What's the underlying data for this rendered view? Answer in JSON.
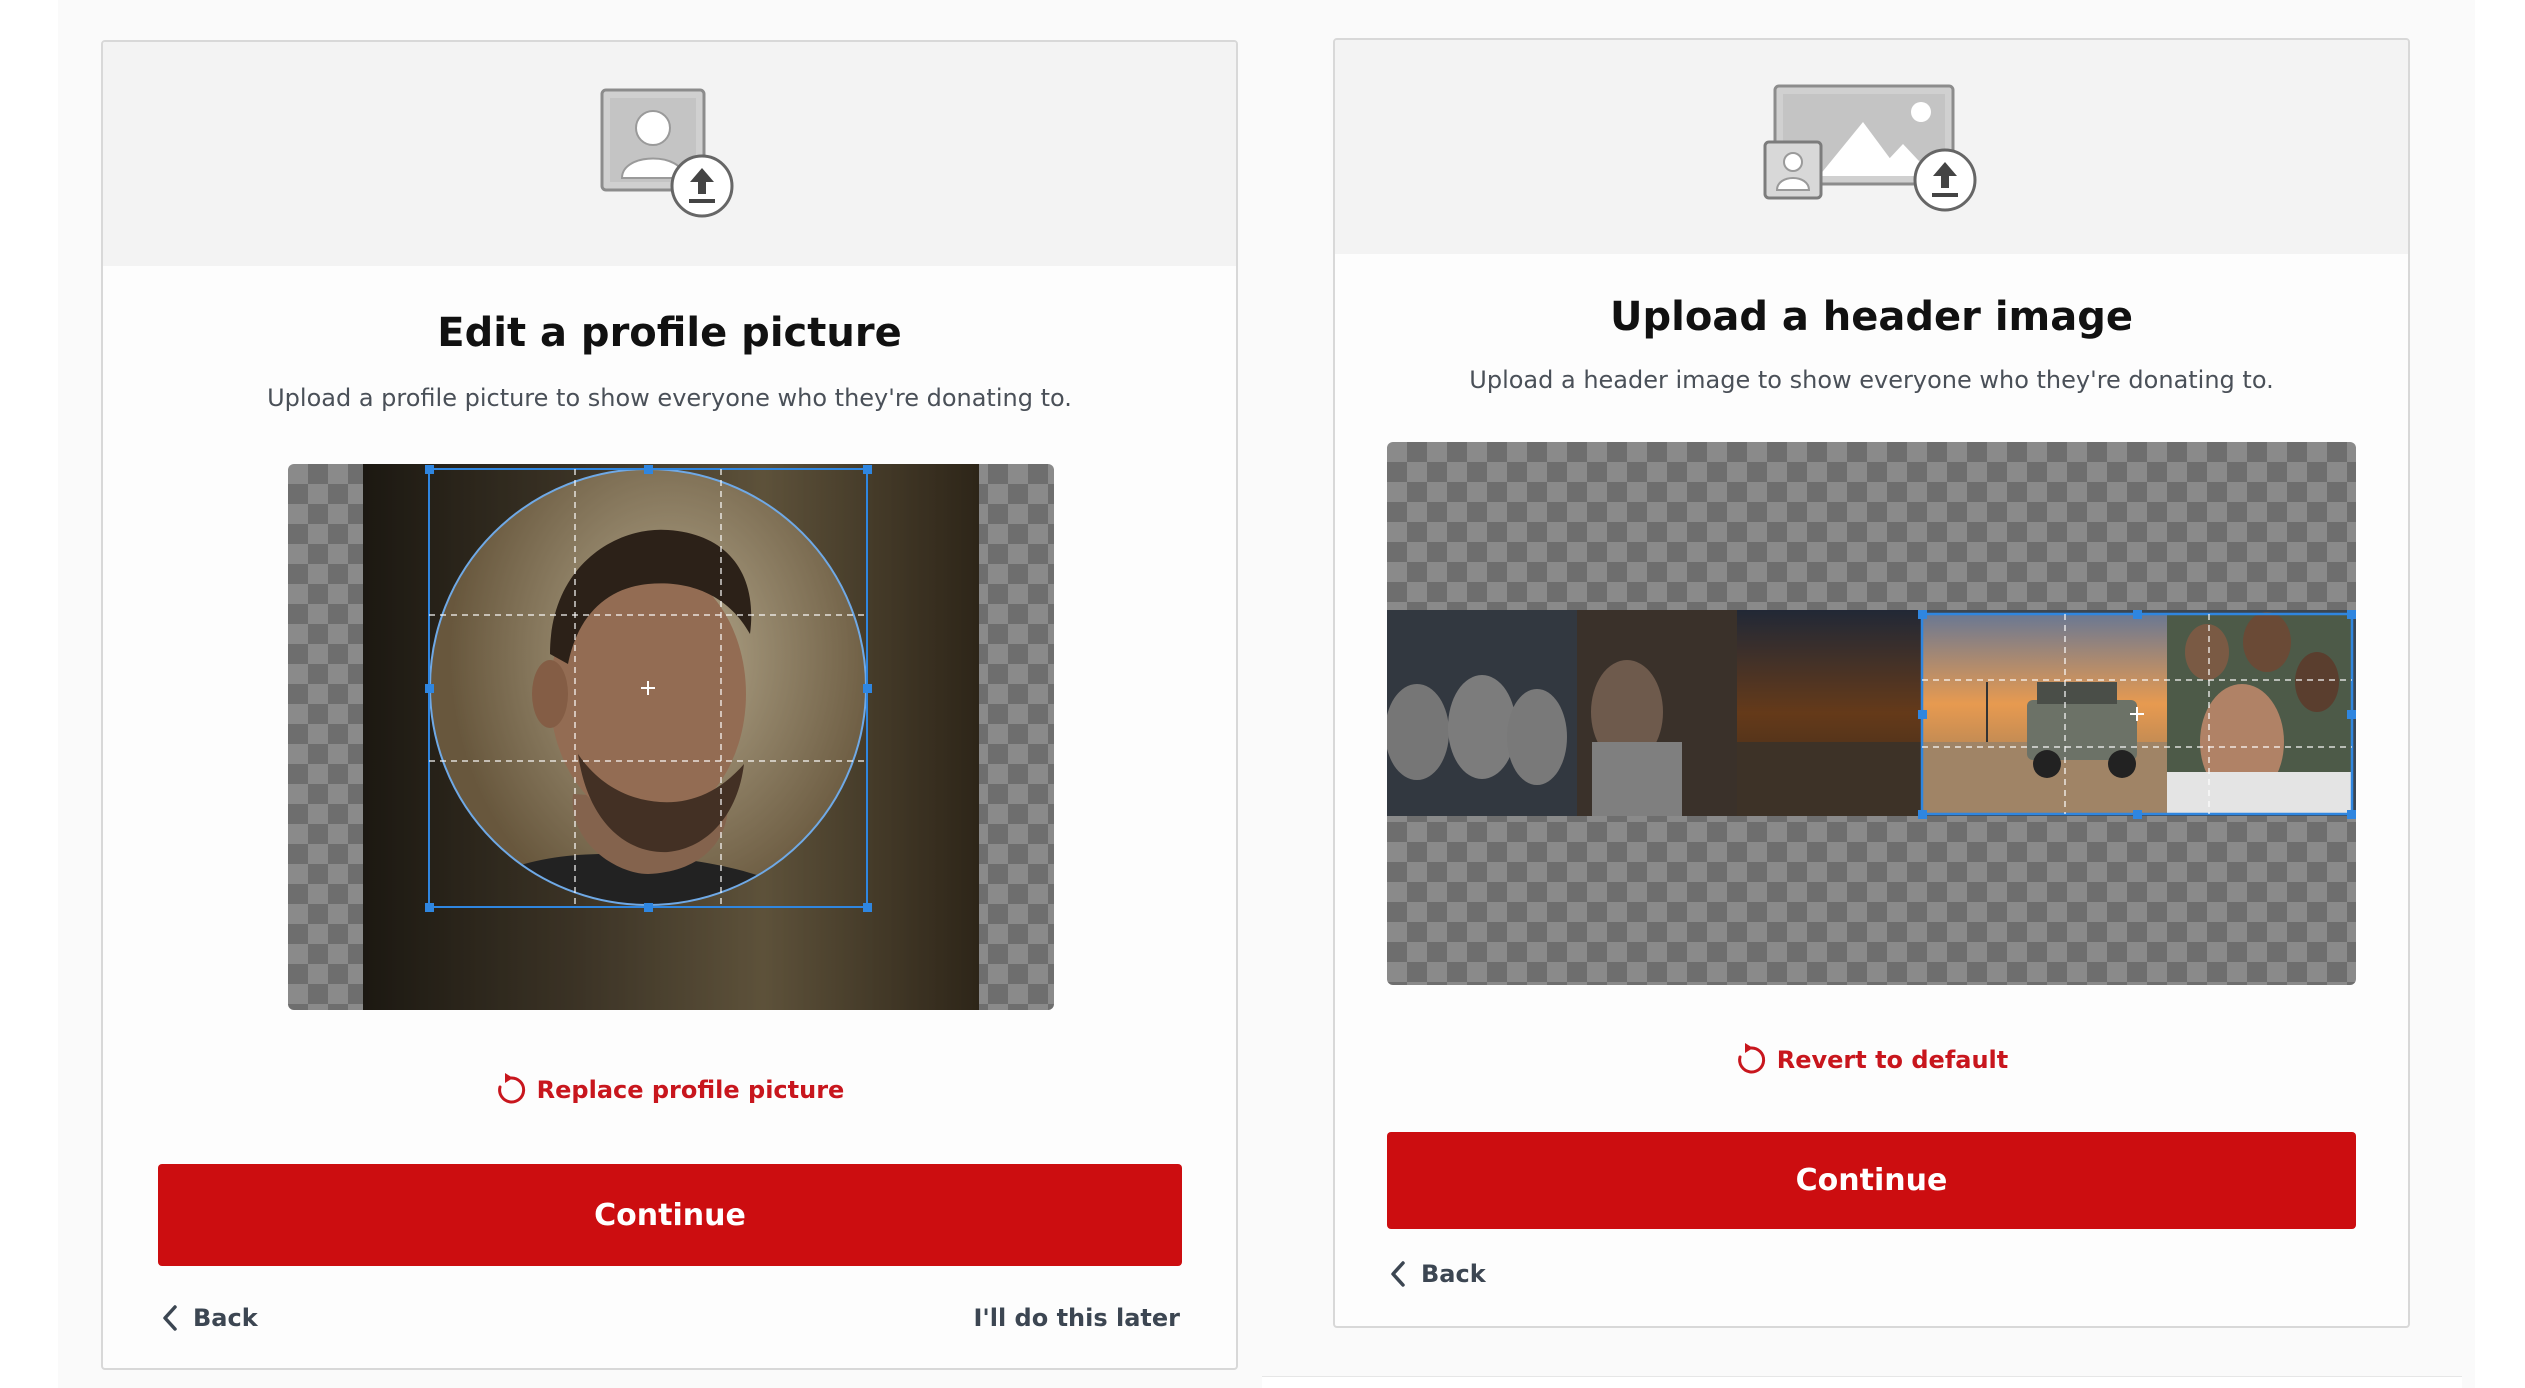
{
  "profile_card": {
    "title": "Edit a profile picture",
    "subtitle": "Upload a profile picture to show everyone who they're donating to.",
    "replace_label": "Replace profile picture",
    "continue_label": "Continue",
    "back_label": "Back",
    "later_label": "I'll do this later",
    "illustration_icon": "profile-upload-icon"
  },
  "header_card": {
    "title": "Upload a header image",
    "subtitle": "Upload a header image to show everyone who they're donating to.",
    "revert_label": "Revert to default",
    "continue_label": "Continue",
    "back_label": "Back",
    "illustration_icon": "header-image-upload-icon"
  },
  "colors": {
    "primary_red": "#cc0d10",
    "link_red": "#c8161d",
    "crop_handle_blue": "#2f86e0",
    "text_dark": "#111111",
    "text_muted": "#4a5058"
  }
}
